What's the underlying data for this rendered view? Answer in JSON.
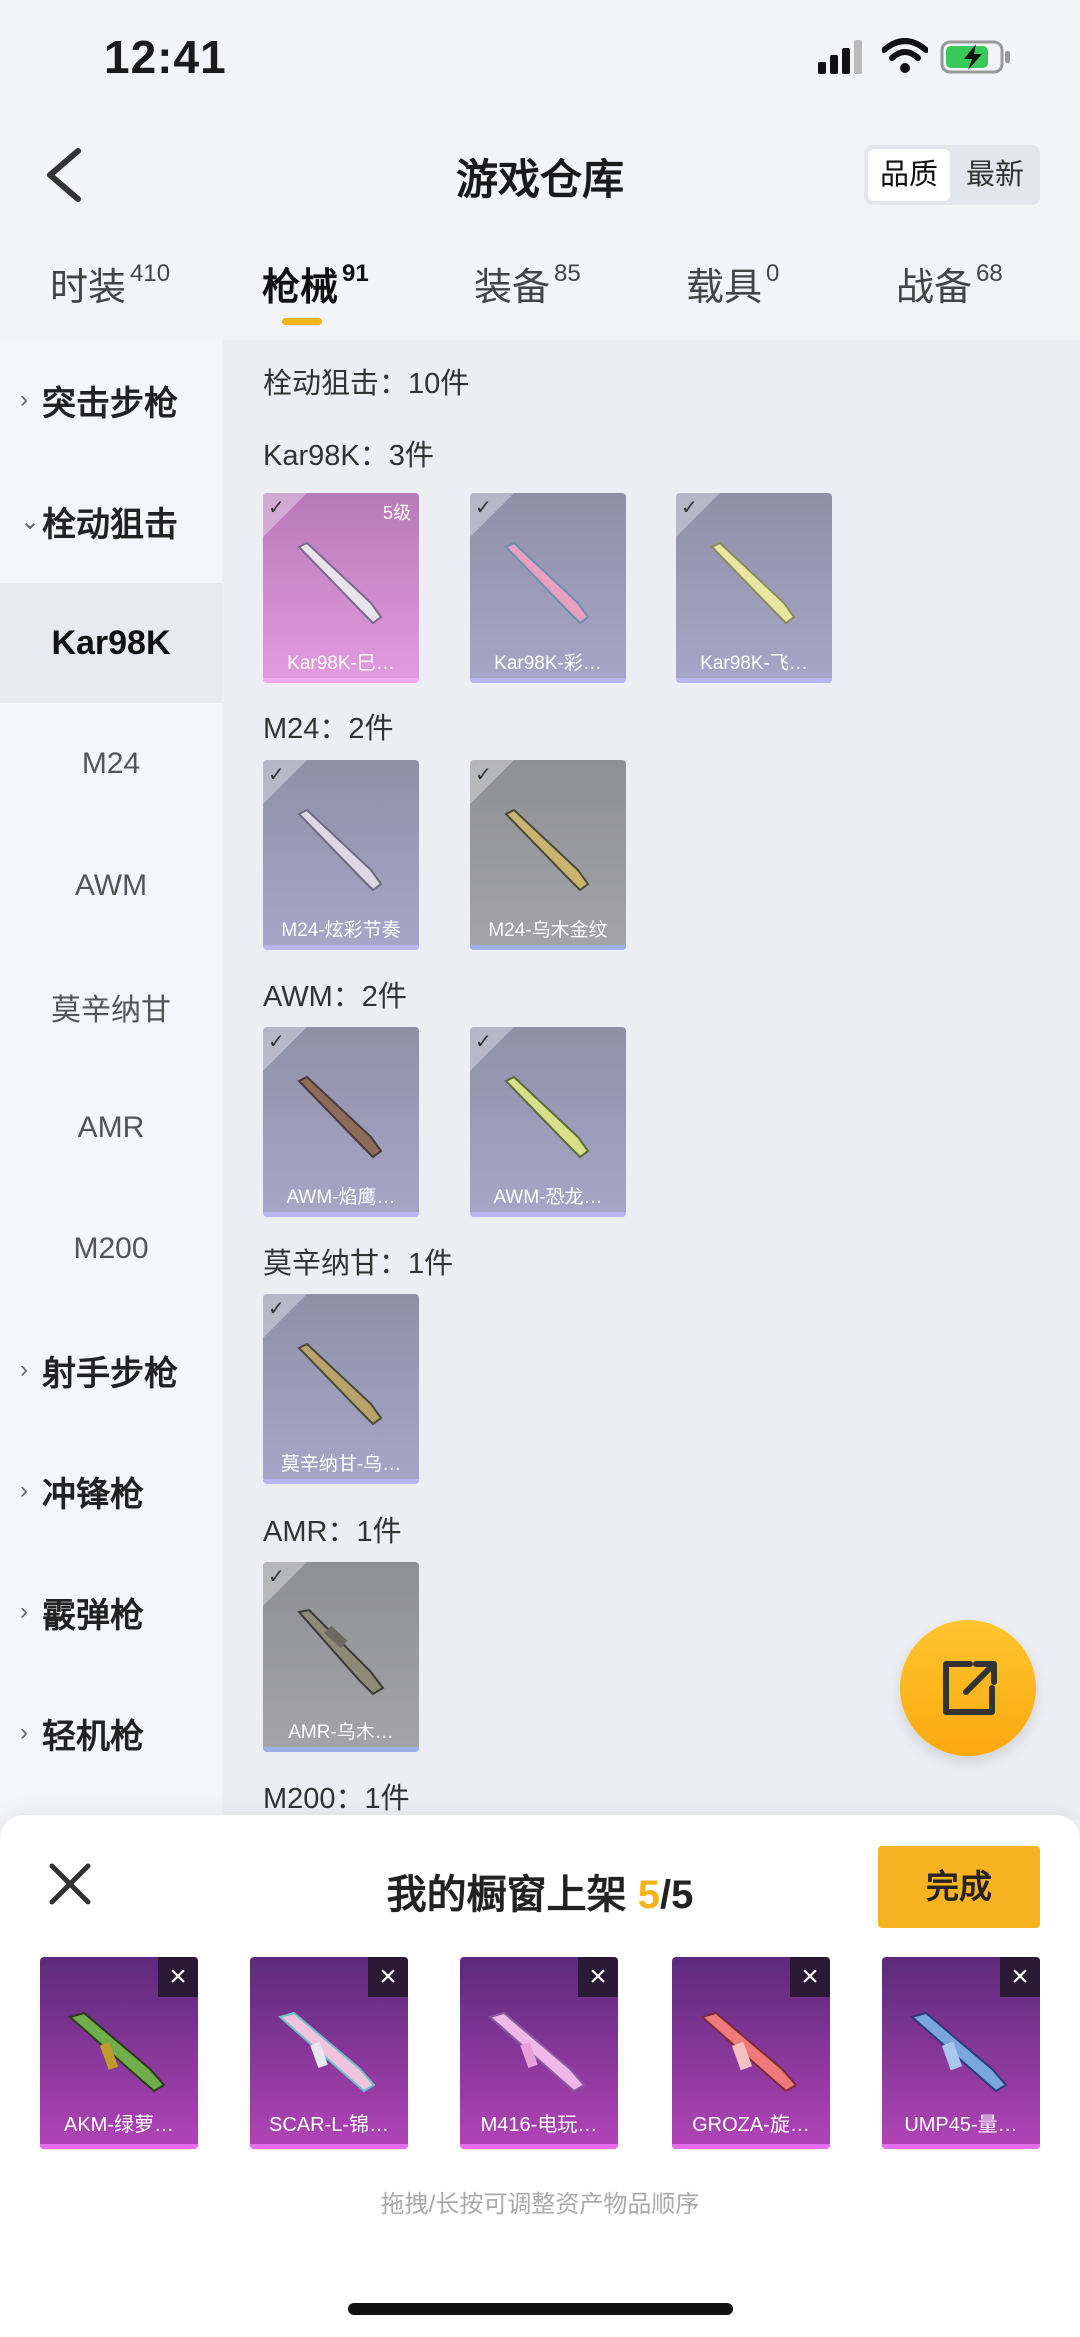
{
  "status": {
    "time": "12:41"
  },
  "header": {
    "title": "游戏仓库",
    "sort_quality": "品质",
    "sort_newest": "最新"
  },
  "tabs": [
    {
      "label": "时装",
      "count": "410"
    },
    {
      "label": "枪械",
      "count": "91"
    },
    {
      "label": "装备",
      "count": "85"
    },
    {
      "label": "载具",
      "count": "0"
    },
    {
      "label": "战备",
      "count": "68"
    }
  ],
  "sidebar": {
    "items": [
      {
        "label": "突击步枪"
      },
      {
        "label": "栓动狙击"
      },
      {
        "label": "Kar98K"
      },
      {
        "label": "M24"
      },
      {
        "label": "AWM"
      },
      {
        "label": "莫辛纳甘"
      },
      {
        "label": "AMR"
      },
      {
        "label": "M200"
      },
      {
        "label": "射手步枪"
      },
      {
        "label": "冲锋枪"
      },
      {
        "label": "霰弹枪"
      },
      {
        "label": "轻机枪"
      }
    ]
  },
  "content": {
    "summary": "栓动狙击：10件",
    "sections": [
      {
        "title": "Kar98K：3件",
        "items": [
          "Kar98K-巳…",
          "Kar98K-彩…",
          "Kar98K-飞…"
        ],
        "level": "5级"
      },
      {
        "title": "M24：2件",
        "items": [
          "M24-炫彩节奏",
          "M24-乌木金纹"
        ]
      },
      {
        "title": "AWM：2件",
        "items": [
          "AWM-焰鹰…",
          "AWM-恐龙…"
        ]
      },
      {
        "title": "莫辛纳甘：1件",
        "items": [
          "莫辛纳甘-乌…"
        ]
      },
      {
        "title": "AMR：1件",
        "items": [
          "AMR-乌木…"
        ]
      },
      {
        "title": "M200：1件"
      }
    ]
  },
  "sheet": {
    "title_prefix": "我的橱窗上架",
    "count": "5",
    "total": "/5",
    "done": "完成",
    "items": [
      "AKM-绿萝…",
      "SCAR-L-锦…",
      "M416-电玩…",
      "GROZA-旋…",
      "UMP45-量…"
    ],
    "hint": "拖拽/长按可调整资产物品顺序"
  }
}
